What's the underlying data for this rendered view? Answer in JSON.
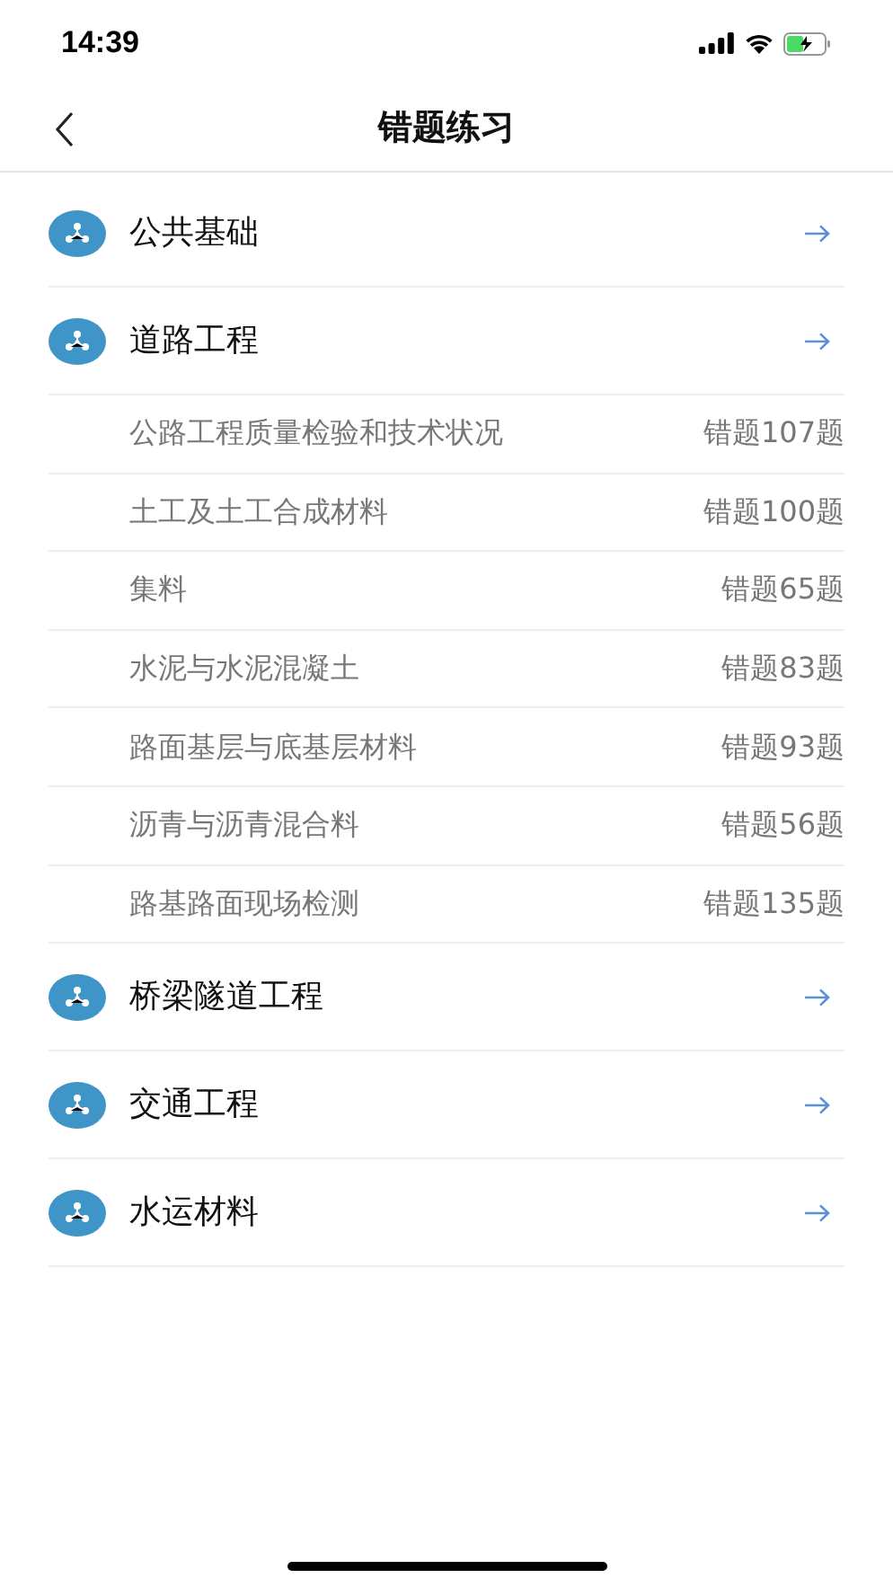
{
  "status_bar": {
    "time": "14:39"
  },
  "nav": {
    "title": "错题练习"
  },
  "categories": [
    {
      "label": "公共基础"
    },
    {
      "label": "道路工程",
      "children": [
        {
          "label": "公路工程质量检验和技术状况",
          "count": "错题107题"
        },
        {
          "label": "土工及土工合成材料",
          "count": "错题100题"
        },
        {
          "label": "集料",
          "count": "错题65题"
        },
        {
          "label": "水泥与水泥混凝土",
          "count": "错题83题"
        },
        {
          "label": "路面基层与底基层材料",
          "count": "错题93题"
        },
        {
          "label": "沥青与沥青混合料",
          "count": "错题56题"
        },
        {
          "label": "路基路面现场检测",
          "count": "错题135题"
        }
      ]
    },
    {
      "label": "桥梁隧道工程"
    },
    {
      "label": "交通工程"
    },
    {
      "label": "水运材料"
    }
  ]
}
